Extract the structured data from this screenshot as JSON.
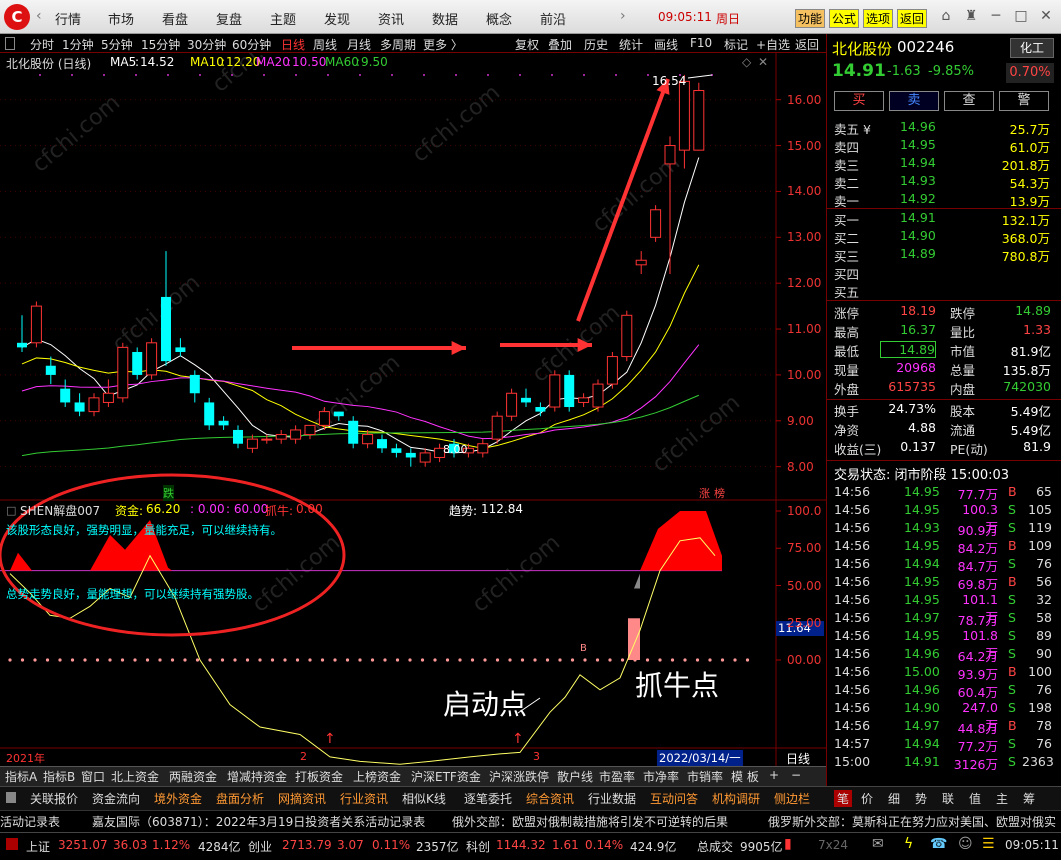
{
  "topmenu": {
    "items": [
      "行情",
      "市场",
      "看盘",
      "复盘",
      "主题",
      "发现",
      "资讯",
      "数据",
      "概念",
      "前沿"
    ],
    "clock": "09:05:11",
    "weekday": "周日",
    "buttons": [
      "功能",
      "公式",
      "选项",
      "返回"
    ]
  },
  "periods": [
    "分时",
    "1分钟",
    "5分钟",
    "15分钟",
    "30分钟",
    "60分钟",
    "日线",
    "周线",
    "月线",
    "多周期",
    "更多 〉"
  ],
  "tools": [
    "复权",
    "叠加",
    "历史",
    "统计",
    "画线",
    "F10",
    "标记",
    "+自选",
    "返回"
  ],
  "chart_data": {
    "type": "candlestick",
    "title": "北化股份 (日线)",
    "ma": [
      {
        "name": "MA5",
        "value": "14.52",
        "color": "#ffffff"
      },
      {
        "name": "MA10",
        "value": "12.20",
        "color": "#ffff00"
      },
      {
        "name": "MA20",
        "value": "10.50",
        "color": "#ff33ff"
      },
      {
        "name": "MA60",
        "value": "9.50",
        "color": "#33cc33"
      }
    ],
    "yticks": [
      "16.00",
      "15.00",
      "14.00",
      "13.00",
      "12.00",
      "11.00",
      "10.00",
      "9.00",
      "8.00"
    ],
    "ylim": [
      7.6,
      16.8
    ],
    "high_label": "16.54",
    "low_label": "8.00",
    "markers": {
      "die": "跌",
      "zhang": "涨",
      "bang": "榜"
    },
    "candles": [
      [
        10.7,
        10.6,
        11.3,
        10.5
      ],
      [
        10.7,
        11.5,
        11.6,
        10.6
      ],
      [
        10.2,
        10.0,
        10.4,
        9.8
      ],
      [
        9.7,
        9.4,
        9.9,
        9.3
      ],
      [
        9.4,
        9.2,
        9.6,
        9.1
      ],
      [
        9.2,
        9.5,
        9.6,
        9.1
      ],
      [
        9.4,
        9.6,
        9.9,
        9.3
      ],
      [
        9.5,
        10.6,
        10.7,
        9.4
      ],
      [
        10.5,
        10.0,
        10.6,
        9.9
      ],
      [
        10.0,
        10.7,
        10.8,
        9.9
      ],
      [
        11.7,
        10.3,
        12.7,
        10.2
      ],
      [
        10.6,
        10.5,
        10.8,
        10.4
      ],
      [
        10.0,
        9.6,
        10.1,
        9.4
      ],
      [
        9.4,
        8.9,
        9.5,
        8.8
      ],
      [
        9.0,
        8.9,
        9.1,
        8.8
      ],
      [
        8.8,
        8.5,
        8.9,
        8.4
      ],
      [
        8.4,
        8.6,
        8.7,
        8.3
      ],
      [
        8.6,
        8.6,
        8.7,
        8.5
      ],
      [
        8.6,
        8.7,
        8.8,
        8.5
      ],
      [
        8.6,
        8.8,
        8.9,
        8.5
      ],
      [
        8.7,
        8.9,
        8.9,
        8.6
      ],
      [
        8.9,
        9.2,
        9.3,
        8.8
      ],
      [
        9.2,
        9.1,
        9.2,
        9.0
      ],
      [
        9.0,
        8.5,
        9.1,
        8.4
      ],
      [
        8.5,
        8.7,
        8.8,
        8.4
      ],
      [
        8.6,
        8.4,
        8.7,
        8.3
      ],
      [
        8.4,
        8.3,
        8.5,
        8.2
      ],
      [
        8.3,
        8.2,
        8.4,
        8.0
      ],
      [
        8.1,
        8.3,
        8.4,
        8.0
      ],
      [
        8.2,
        8.4,
        8.5,
        8.1
      ],
      [
        8.5,
        8.3,
        8.6,
        8.2
      ],
      [
        8.3,
        8.4,
        8.5,
        8.2
      ],
      [
        8.3,
        8.5,
        8.6,
        8.2
      ],
      [
        8.6,
        9.1,
        9.2,
        8.5
      ],
      [
        9.1,
        9.6,
        9.7,
        9.0
      ],
      [
        9.5,
        9.4,
        9.7,
        9.3
      ],
      [
        9.3,
        9.2,
        9.4,
        9.1
      ],
      [
        9.3,
        10.0,
        10.1,
        9.2
      ],
      [
        10.0,
        9.3,
        10.1,
        9.2
      ],
      [
        9.4,
        9.5,
        9.6,
        9.3
      ],
      [
        9.3,
        9.8,
        9.9,
        9.2
      ],
      [
        9.8,
        10.4,
        10.5,
        9.7
      ],
      [
        10.4,
        11.3,
        11.4,
        10.3
      ],
      [
        12.4,
        12.5,
        12.7,
        12.2
      ],
      [
        13.0,
        13.6,
        13.7,
        12.9
      ],
      [
        14.6,
        15.0,
        15.2,
        12.2
      ],
      [
        14.9,
        16.4,
        16.54,
        14.5
      ],
      [
        14.9,
        16.2,
        16.37,
        14.89
      ]
    ]
  },
  "indicator": {
    "name": "SHEN解盘007",
    "zijin_label": "资金:",
    "zijin_value": "66.20",
    "val2": ": 0.00",
    "val3": ": 60.00",
    "zhuaniu_label": "抓牛:",
    "zhuaniu_value": "0.00",
    "trend_label": "趋势:",
    "trend_value": "112.84",
    "yticks": [
      "100.0",
      "75.00",
      "50.00",
      "25.00",
      "00.00"
    ],
    "current_value": "11.64",
    "comment1": "该股形态良好，强势明显，量能充足，可以继续持有。",
    "comment2": "总势走势良好，量能理想，可以继续持有强势股。",
    "b_marker": "B",
    "annotation_start": "启动点",
    "annotation_bull": "抓牛点",
    "x_labels": [
      "2021年",
      "2",
      "3"
    ],
    "date_label": "2022/03/14/一",
    "period_label": "日线",
    "watermark": "cfchi.com"
  },
  "stock": {
    "name": "北化股份",
    "code": "002246",
    "sector": "化工",
    "price": "14.91",
    "change": "-1.63",
    "change_pct": "-9.85%",
    "rate": "0.70%",
    "buttons": [
      "买",
      "卖",
      "查",
      "警"
    ]
  },
  "orderbook": {
    "asks": [
      {
        "label": "卖五 ¥",
        "price": "14.96",
        "vol": "25.7万"
      },
      {
        "label": "卖四",
        "price": "14.95",
        "vol": "61.0万"
      },
      {
        "label": "卖三",
        "price": "14.94",
        "vol": "201.8万"
      },
      {
        "label": "卖二",
        "price": "14.93",
        "vol": "54.3万"
      },
      {
        "label": "卖一",
        "price": "14.92",
        "vol": "13.9万"
      }
    ],
    "bids": [
      {
        "label": "买一",
        "price": "14.91",
        "vol": "132.1万"
      },
      {
        "label": "买二",
        "price": "14.90",
        "vol": "368.0万"
      },
      {
        "label": "买三",
        "price": "14.89",
        "vol": "780.8万"
      },
      {
        "label": "买四",
        "price": "",
        "vol": ""
      },
      {
        "label": "买五",
        "price": "",
        "vol": ""
      }
    ]
  },
  "quote": [
    {
      "l1": "涨停",
      "v1": "18.19",
      "c1": "red",
      "l2": "跌停",
      "v2": "14.89",
      "c2": "green"
    },
    {
      "l1": "最高",
      "v1": "16.37",
      "c1": "green",
      "l2": "量比",
      "v2": "1.33",
      "c2": "red"
    },
    {
      "l1": "最低",
      "v1": "14.89",
      "c1": "green",
      "l2": "市值",
      "v2": "81.9亿",
      "c2": "white"
    },
    {
      "l1": "现量",
      "v1": "20968",
      "c1": "magenta",
      "l2": "总量",
      "v2": "135.8万",
      "c2": "white"
    },
    {
      "l1": "外盘",
      "v1": "615735",
      "c1": "red",
      "l2": "内盘",
      "v2": "742030",
      "c2": "green"
    },
    {
      "l1": "换手",
      "v1": "24.73%",
      "c1": "white",
      "l2": "股本",
      "v2": "5.49亿",
      "c2": "white"
    },
    {
      "l1": "净资",
      "v1": "4.88",
      "c1": "white",
      "l2": "流通",
      "v2": "5.49亿",
      "c2": "white"
    },
    {
      "l1": "收益(三)",
      "v1": "0.137",
      "c1": "white",
      "l2": "PE(动)",
      "v2": "81.9",
      "c2": "white"
    }
  ],
  "trade_status": "交易状态: 闭市阶段 15:00:03",
  "trades": [
    {
      "t": "14:56",
      "p": "14.95",
      "v": "77.7万",
      "bs": "B",
      "n": "65"
    },
    {
      "t": "14:56",
      "p": "14.95",
      "v": "100.3万",
      "bs": "S",
      "n": "105"
    },
    {
      "t": "14:56",
      "p": "14.93",
      "v": "90.9万",
      "bs": "S",
      "n": "119"
    },
    {
      "t": "14:56",
      "p": "14.95",
      "v": "84.2万",
      "bs": "B",
      "n": "109"
    },
    {
      "t": "14:56",
      "p": "14.94",
      "v": "84.7万",
      "bs": "S",
      "n": "76"
    },
    {
      "t": "14:56",
      "p": "14.95",
      "v": "69.8万",
      "bs": "B",
      "n": "56"
    },
    {
      "t": "14:56",
      "p": "14.95",
      "v": "101.1万",
      "bs": "S",
      "n": "32"
    },
    {
      "t": "14:56",
      "p": "14.97",
      "v": "78.7万",
      "bs": "S",
      "n": "58"
    },
    {
      "t": "14:56",
      "p": "14.95",
      "v": "101.8万",
      "bs": "S",
      "n": "89"
    },
    {
      "t": "14:56",
      "p": "14.96",
      "v": "64.2万",
      "bs": "S",
      "n": "90"
    },
    {
      "t": "14:56",
      "p": "15.00",
      "v": "93.9万",
      "bs": "B",
      "n": "100"
    },
    {
      "t": "14:56",
      "p": "14.96",
      "v": "60.4万",
      "bs": "S",
      "n": "76"
    },
    {
      "t": "14:56",
      "p": "14.90",
      "v": "247.0万",
      "bs": "S",
      "n": "198"
    },
    {
      "t": "14:56",
      "p": "14.97",
      "v": "44.8万",
      "bs": "B",
      "n": "78"
    },
    {
      "t": "14:57",
      "p": "14.94",
      "v": "77.2万",
      "bs": "S",
      "n": "76"
    },
    {
      "t": "15:00",
      "p": "14.91",
      "v": "3126万",
      "bs": "S",
      "n": "2363"
    }
  ],
  "tabs1": [
    "指标A",
    "指标B",
    "窗口",
    "北上资金",
    "两融资金",
    "增减持资金",
    "打板资金",
    "上榜资金",
    "沪深ETF资金",
    "沪深涨跌停",
    "散户线",
    "市盈率",
    "市净率",
    "市销率",
    "模 板",
    "+",
    "−"
  ],
  "tabs2": [
    "关联报价",
    "资金流向",
    "境外资金",
    "盘面分析",
    "网摘资讯",
    "行业资讯",
    "相似K线",
    "逐笔委托",
    "综合资讯",
    "行业数据",
    "互动问答",
    "机构调研",
    "侧边栏"
  ],
  "tabs2_right": [
    "笔",
    "价",
    "细",
    "势",
    "联",
    "值",
    "主",
    "筹"
  ],
  "ticker": [
    "活动记录表",
    "嘉友国际（603871）：2022年3月19日投资者关系活动记录表",
    "俄外交部：欧盟对俄制裁措施将引发不可逆转的后果",
    "俄罗斯外交部：莫斯科正在努力应对美国、欧盟对俄实"
  ],
  "status_bar": {
    "sh_label": "上证",
    "sh_val": "3251.07",
    "sh_chg": "36.03",
    "sh_pct": "1.12%",
    "sh_amt": "4284亿",
    "cy_label": "创业",
    "cy_val": "2713.79",
    "cy_chg": "3.07",
    "cy_pct": "0.11%",
    "cy_amt": "2357亿",
    "kc_label": "科创",
    "kc_val": "1144.32",
    "kc_chg": "1.61",
    "kc_pct": "0.14%",
    "kc_amt": "424.9亿",
    "total_label": "总成交",
    "total_val": "9905亿",
    "net": "7x24",
    "time": "09:05:11"
  }
}
